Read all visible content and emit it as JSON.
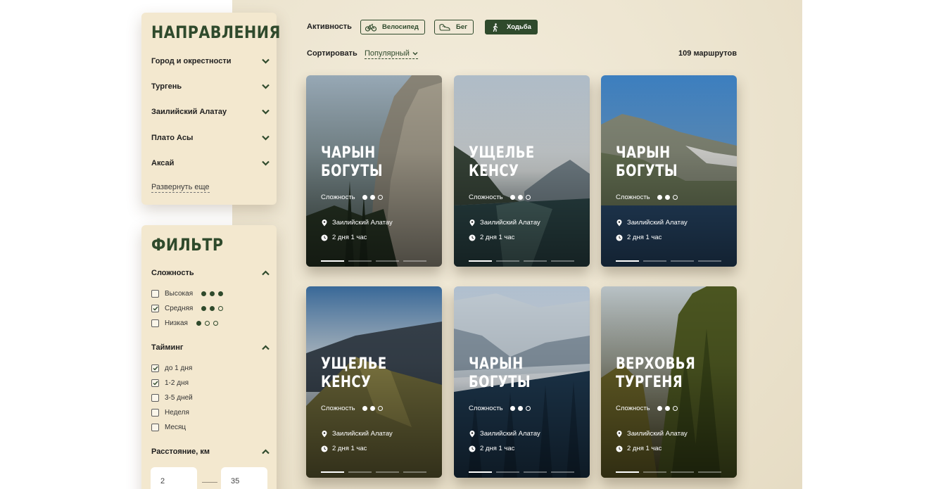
{
  "directions": {
    "title": "НАПРАВЛЕНИЯ",
    "items": [
      {
        "label": "Город и окрестности"
      },
      {
        "label": "Тургень"
      },
      {
        "label": "Заилийский Алатау"
      },
      {
        "label": "Плато Асы"
      },
      {
        "label": "Аксай"
      }
    ],
    "expand_label": "Развернуть еще"
  },
  "filter": {
    "title": "ФИЛЬТР",
    "difficulty": {
      "label": "Сложность",
      "options": [
        {
          "label": "Высокая",
          "checked": false,
          "level": 3
        },
        {
          "label": "Средняя",
          "checked": true,
          "level": 2
        },
        {
          "label": "Низкая",
          "checked": false,
          "level": 1
        }
      ]
    },
    "timing": {
      "label": "Тайминг",
      "options": [
        {
          "label": "до 1 дня",
          "checked": true
        },
        {
          "label": "1-2 дня",
          "checked": true
        },
        {
          "label": "3-5 дней",
          "checked": false
        },
        {
          "label": "Неделя",
          "checked": false
        },
        {
          "label": "Месяц",
          "checked": false
        }
      ]
    },
    "distance": {
      "label": "Расстояние, км",
      "min": "2",
      "max": "35"
    }
  },
  "activity": {
    "label": "Активность",
    "buttons": [
      {
        "label": "Велосипед",
        "icon": "bicycle-icon",
        "active": false
      },
      {
        "label": "Бег",
        "icon": "running-shoe-icon",
        "active": false
      },
      {
        "label": "Ходьба",
        "icon": "walking-person-icon",
        "active": true
      }
    ]
  },
  "sort": {
    "label": "Сортировать",
    "value": "Популярный"
  },
  "route_count": "109 маршрутов",
  "colors": {
    "accent": "#2f4a2c",
    "panel": "#f3e8cf",
    "paper": "#ece4cf"
  },
  "cards": [
    {
      "title_l1": "ЧАРЫН",
      "title_l2": "БОГУТЫ",
      "difficulty_label": "Сложность",
      "difficulty": 2,
      "region": "Заилийский Алатау",
      "duration": "2 дня 1 час",
      "slide": 1,
      "slides": 4
    },
    {
      "title_l1": "УЩЕЛЬЕ",
      "title_l2": "КЕНСУ",
      "difficulty_label": "Сложность",
      "difficulty": 2,
      "region": "Заилийский Алатау",
      "duration": "2 дня 1 час",
      "slide": 1,
      "slides": 4
    },
    {
      "title_l1": "ЧАРЫН",
      "title_l2": "БОГУТЫ",
      "difficulty_label": "Сложность",
      "difficulty": 2,
      "region": "Заилийский Алатау",
      "duration": "2 дня 1 час",
      "slide": 1,
      "slides": 4
    },
    {
      "title_l1": "УЩЕЛЬЕ",
      "title_l2": "КЕНСУ",
      "difficulty_label": "Сложность",
      "difficulty": 2,
      "region": "Заилийский Алатау",
      "duration": "2 дня 1 час",
      "slide": 1,
      "slides": 4
    },
    {
      "title_l1": "ЧАРЫН",
      "title_l2": "БОГУТЫ",
      "difficulty_label": "Сложность",
      "difficulty": 2,
      "region": "Заилийский Алатау",
      "duration": "2 дня 1 час",
      "slide": 1,
      "slides": 4
    },
    {
      "title_l1": "ВЕРХОВЬЯ",
      "title_l2": "ТУРГЕНЯ",
      "difficulty_label": "Сложность",
      "difficulty": 2,
      "region": "Заилийский Алатау",
      "duration": "2 дня 1 час",
      "slide": 1,
      "slides": 4
    }
  ]
}
